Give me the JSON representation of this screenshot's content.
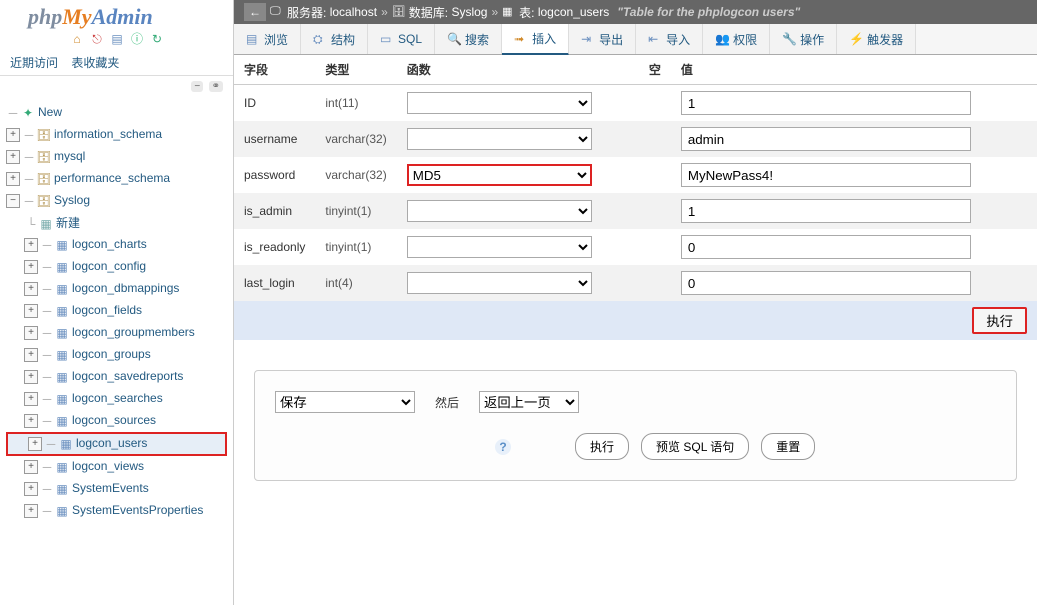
{
  "logo": {
    "p1": "php",
    "p2": "My",
    "p3": "Admin"
  },
  "nav": {
    "recent": "近期访问",
    "favorites": "表收藏夹"
  },
  "tree": {
    "new": "New",
    "dbs": [
      {
        "name": "information_schema",
        "open": false
      },
      {
        "name": "mysql",
        "open": false
      },
      {
        "name": "performance_schema",
        "open": false
      },
      {
        "name": "Syslog",
        "open": true,
        "newTable": "新建",
        "tables": [
          "logcon_charts",
          "logcon_config",
          "logcon_dbmappings",
          "logcon_fields",
          "logcon_groupmembers",
          "logcon_groups",
          "logcon_savedreports",
          "logcon_searches",
          "logcon_sources",
          "logcon_users",
          "logcon_views",
          "SystemEvents",
          "SystemEventsProperties"
        ],
        "highlight": "logcon_users"
      }
    ]
  },
  "breadcrumb": {
    "server_lbl": "服务器:",
    "server_val": "localhost",
    "db_lbl": "数据库:",
    "db_val": "Syslog",
    "tbl_lbl": "表:",
    "tbl_val": "logcon_users",
    "comment": "\"Table for the phplogcon users\""
  },
  "tabs": [
    {
      "label": "浏览",
      "icon": "list-icon"
    },
    {
      "label": "结构",
      "icon": "struct-icon"
    },
    {
      "label": "SQL",
      "icon": "sql-icon"
    },
    {
      "label": "搜索",
      "icon": "search-icon"
    },
    {
      "label": "插入",
      "icon": "insert-icon",
      "active": true
    },
    {
      "label": "导出",
      "icon": "export-icon"
    },
    {
      "label": "导入",
      "icon": "import-icon"
    },
    {
      "label": "权限",
      "icon": "priv-icon"
    },
    {
      "label": "操作",
      "icon": "wrench-icon"
    },
    {
      "label": "触发器",
      "icon": "trigger-icon"
    }
  ],
  "colheaders": {
    "field": "字段",
    "type": "类型",
    "func": "函数",
    "null": "空",
    "value": "值"
  },
  "rows": [
    {
      "field": "ID",
      "type": "int(11)",
      "func": "",
      "value": "1"
    },
    {
      "field": "username",
      "type": "varchar(32)",
      "func": "",
      "value": "admin"
    },
    {
      "field": "password",
      "type": "varchar(32)",
      "func": "MD5",
      "value": "MyNewPass4!",
      "hlFunc": true
    },
    {
      "field": "is_admin",
      "type": "tinyint(1)",
      "func": "",
      "value": "1"
    },
    {
      "field": "is_readonly",
      "type": "tinyint(1)",
      "func": "",
      "value": "0"
    },
    {
      "field": "last_login",
      "type": "int(4)",
      "func": "",
      "value": "0"
    }
  ],
  "buttons": {
    "go": "执行",
    "exec": "执行",
    "preview": "预览 SQL 语句",
    "reset": "重置"
  },
  "options": {
    "save_sel": "保存",
    "then": "然后",
    "back_sel": "返回上一页"
  }
}
